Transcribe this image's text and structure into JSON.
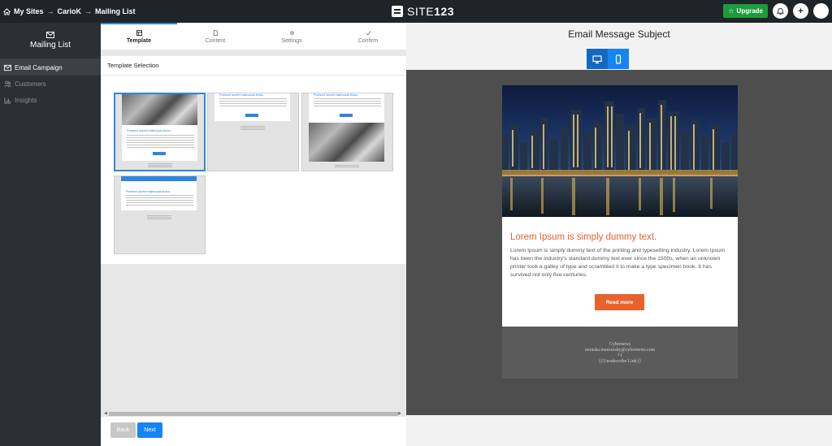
{
  "breadcrumb": {
    "items": [
      "My Sites",
      "CarioK",
      "Mailing List"
    ]
  },
  "logo": {
    "text": "SITE",
    "number": "123"
  },
  "top_actions": {
    "upgrade_label": "Upgrade",
    "notifications_icon": "bell-icon",
    "add_icon": "plus-icon",
    "avatar": "avatar"
  },
  "sidebar": {
    "title": "Mailing List",
    "icon": "envelope-icon",
    "items": [
      {
        "label": "Email Campaign",
        "icon": "envelope-icon",
        "active": true
      },
      {
        "label": "Customers",
        "icon": "users-icon",
        "active": false
      },
      {
        "label": "Insights",
        "icon": "chart-icon",
        "active": false
      }
    ]
  },
  "tabs": [
    {
      "label": "Template",
      "icon": "grid-icon",
      "active": true
    },
    {
      "label": "Content",
      "icon": "document-icon",
      "active": false
    },
    {
      "label": "Settings",
      "icon": "gear-icon",
      "active": false
    },
    {
      "label": "Confirm",
      "icon": "check-icon",
      "active": false
    }
  ],
  "template_selection": {
    "title": "Template Selection",
    "templates": [
      {
        "heading": "Praesent laoreet malesuada lectus.",
        "selected": true
      },
      {
        "heading": "Praesent laoreet malesuada lectus.",
        "selected": false
      },
      {
        "heading": "Praesent laoreet malesuada lectus.",
        "selected": false
      },
      {
        "heading": "Praesent laoreet malesuada lectus.",
        "selected": false
      }
    ]
  },
  "navigation": {
    "back_label": "Back",
    "next_label": "Next"
  },
  "preview": {
    "subject": "Email Message Subject",
    "devices": [
      {
        "name": "desktop-icon",
        "active": true
      },
      {
        "name": "mobile-icon",
        "active": false
      }
    ],
    "email": {
      "title": "Lorem Ipsum is simply dummy text.",
      "body": "Lorem Ipsum is simply dummy text of the printing and typesetting industry. Lorem Ipsum has been the industry's standard dummy text ever since the 1500s, when an unknown printer took a galley of type and scrambled it to make a type specimen book. It has survived not only five centuries.",
      "button_label": "Read more",
      "footer": {
        "company": "Cybernews",
        "email": "mouska.mansursky@cybernews.com",
        "phone": "+1",
        "unsubscribe": "{{Unsubscribe Link}}"
      }
    }
  },
  "colors": {
    "accent": "#1585f5",
    "brand_orange": "#e8622c",
    "upgrade": "#1d9b3c",
    "topbar": "#1f2428",
    "sidebar": "#2b3034"
  }
}
